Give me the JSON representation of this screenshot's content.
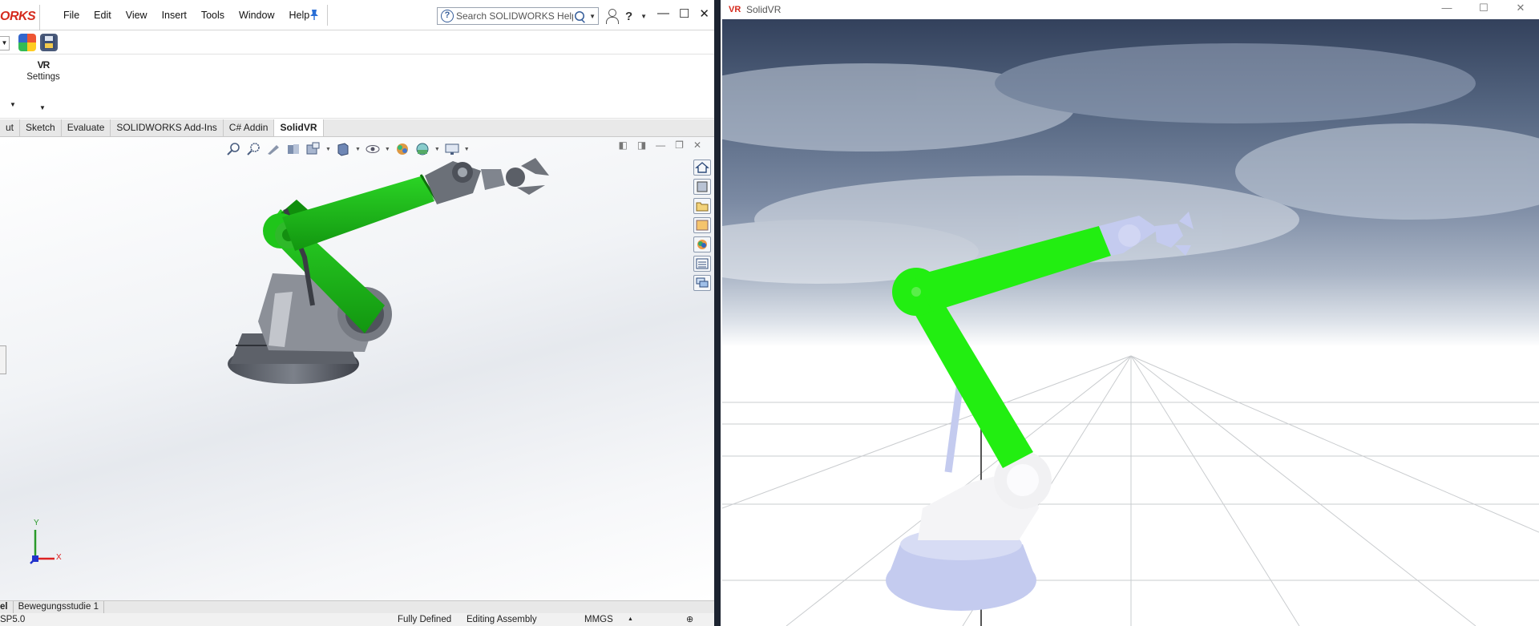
{
  "solidworks": {
    "brand": "ORKS",
    "menu": [
      "File",
      "Edit",
      "View",
      "Insert",
      "Tools",
      "Window",
      "Help"
    ],
    "search_placeholder": "Search SOLIDWORKS Help",
    "ribbon": {
      "vr_logo": "VR",
      "settings_label": "Settings"
    },
    "tabs": [
      "ut",
      "Sketch",
      "Evaluate",
      "SOLIDWORKS Add-Ins",
      "C# Addin",
      "SolidVR"
    ],
    "active_tab": "SolidVR",
    "triad": {
      "y": "Y",
      "x": "X"
    },
    "bottom_tabs": [
      "el",
      "Bewegungsstudie 1"
    ],
    "status": {
      "version": "SP5.0",
      "defined": "Fully Defined",
      "mode": "Editing Assembly",
      "units": "MMGS"
    },
    "colors": {
      "accent": "#d52b1e",
      "arm_green": "#22c41d",
      "part_grey": "#6e727a"
    }
  },
  "solidvr": {
    "title": "SolidVR",
    "logo": "VR",
    "colors": {
      "arm_green": "#22ee11",
      "body_lavender": "#c4cbef",
      "base_white": "#f2f2f4"
    }
  }
}
